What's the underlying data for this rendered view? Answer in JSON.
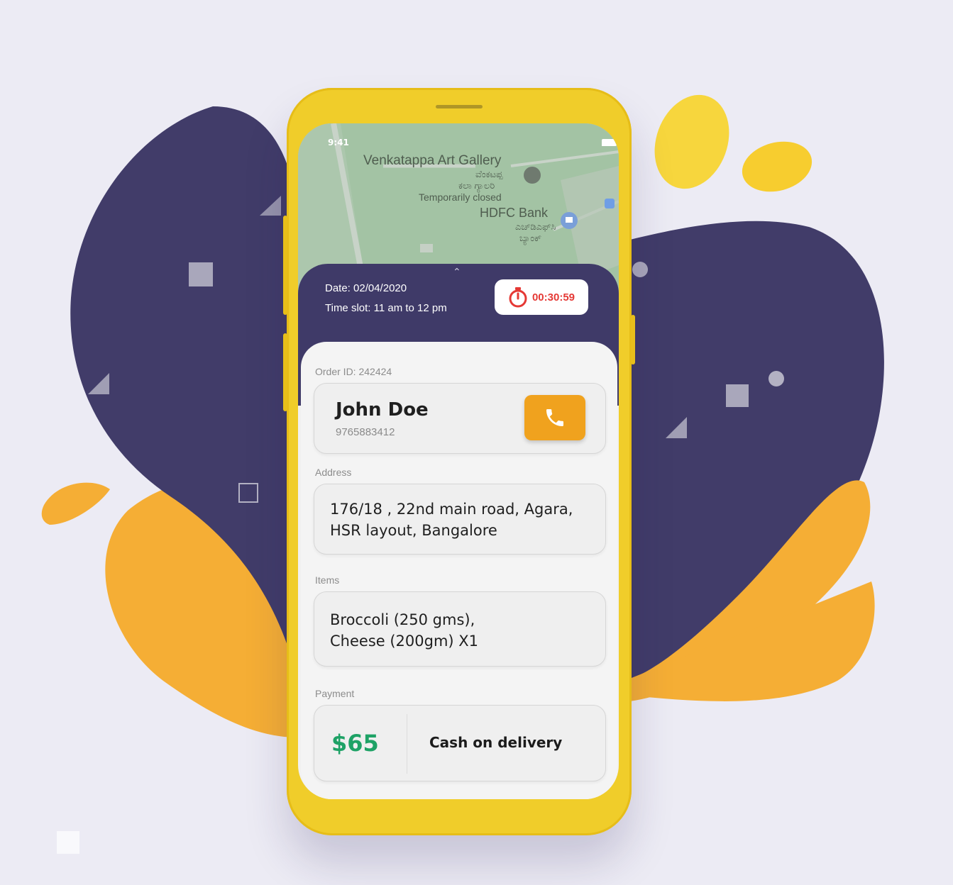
{
  "status_bar": {
    "time": "9:41"
  },
  "map": {
    "labels": {
      "gallery": "Venkatappa Art Gallery",
      "gallery_local_1": "ವೆಂಕಟಪ್ಪ",
      "gallery_local_2": "ಕಲಾ ಗ್ಯಾಲರಿ",
      "gallery_status": "Temporarily closed",
      "bank": "HDFC Bank",
      "bank_local_1": "ಎಚ್‌ಡಿಎಫ್‌ಸಿ",
      "bank_local_2": "ಬ್ಯಾಂಕ್"
    }
  },
  "delivery": {
    "date": "Date: 02/04/2020",
    "time_slot": "Time slot: 11 am to 12 pm",
    "timer": "00:30:59"
  },
  "order": {
    "id_label": "Order ID: 242424",
    "customer_name": "John Doe",
    "customer_phone": "9765883412",
    "address_label": "Address",
    "address_line1": "176/18 , 22nd main road, Agara,",
    "address_line2": "HSR layout, Bangalore",
    "items_label": "Items",
    "items_line1": "Broccoli (250 gms),",
    "items_line2": "Cheese (200gm) X1",
    "payment_label": "Payment",
    "amount": "$65",
    "payment_method": "Cash on delivery"
  },
  "colors": {
    "background": "#ecebf4",
    "blob_dark": "#413c69",
    "blob_orange": "#f5ae35",
    "blob_yellow": "#f7d63d",
    "phone_body": "#f0cd2a",
    "panel_dark": "#3f3a68",
    "call_button": "#f0a21e",
    "amount_green": "#1ea266",
    "timer_red": "#e53935"
  },
  "icons": [
    "stopwatch-icon",
    "phone-icon",
    "chevron-up-icon",
    "signal-icon",
    "wifi-icon",
    "battery-icon",
    "map-pin-icon"
  ]
}
